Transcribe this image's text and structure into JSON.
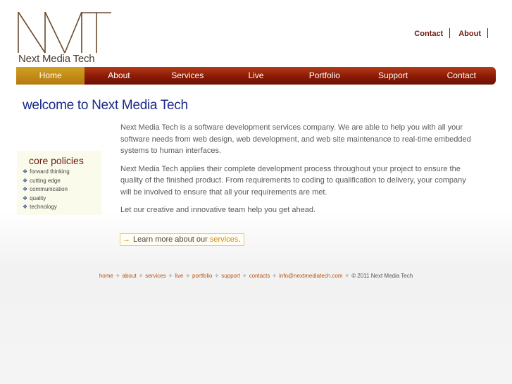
{
  "brand": {
    "logo_text": "Next Media Tech",
    "monogram": "NMT",
    "colors": {
      "logo": "#6b4a2a",
      "nav": "#8a1a05",
      "active": "#c08a18",
      "title": "#1a2a8a"
    }
  },
  "toplinks": [
    {
      "label": "Contact"
    },
    {
      "label": "About"
    }
  ],
  "nav": [
    {
      "label": "Home",
      "active": true
    },
    {
      "label": "About"
    },
    {
      "label": "Services"
    },
    {
      "label": "Live"
    },
    {
      "label": "Portfolio"
    },
    {
      "label": "Support"
    },
    {
      "label": "Contact"
    }
  ],
  "page_title": "welcome to Next Media Tech",
  "policies": {
    "title": "core policies",
    "items": [
      "forward thinking",
      "cutting edge",
      "communication",
      "quality",
      "technology"
    ]
  },
  "content": {
    "paragraphs": [
      "Next Media Tech is a software development services company. We are able to help you with all your software needs from web design, web development, and web site maintenance to real-time embedded systems to human interfaces.",
      "Next Media Tech applies their complete development process throughout your project to ensure the quality of the finished product. From requirements to coding to qualification to delivery, your company will be involved to ensure that all your requirements are met.",
      "Let our creative and innovative team help you get ahead."
    ]
  },
  "learn_more": {
    "prefix": "Learn more about our ",
    "link": "services",
    "suffix": "."
  },
  "footer": {
    "links": [
      "home",
      "about",
      "services",
      "live",
      "portfolio",
      "support",
      "contacts",
      "info@nextmediatech.com"
    ],
    "separator": "✧",
    "copyright": "© 2011 Next Media Tech"
  }
}
